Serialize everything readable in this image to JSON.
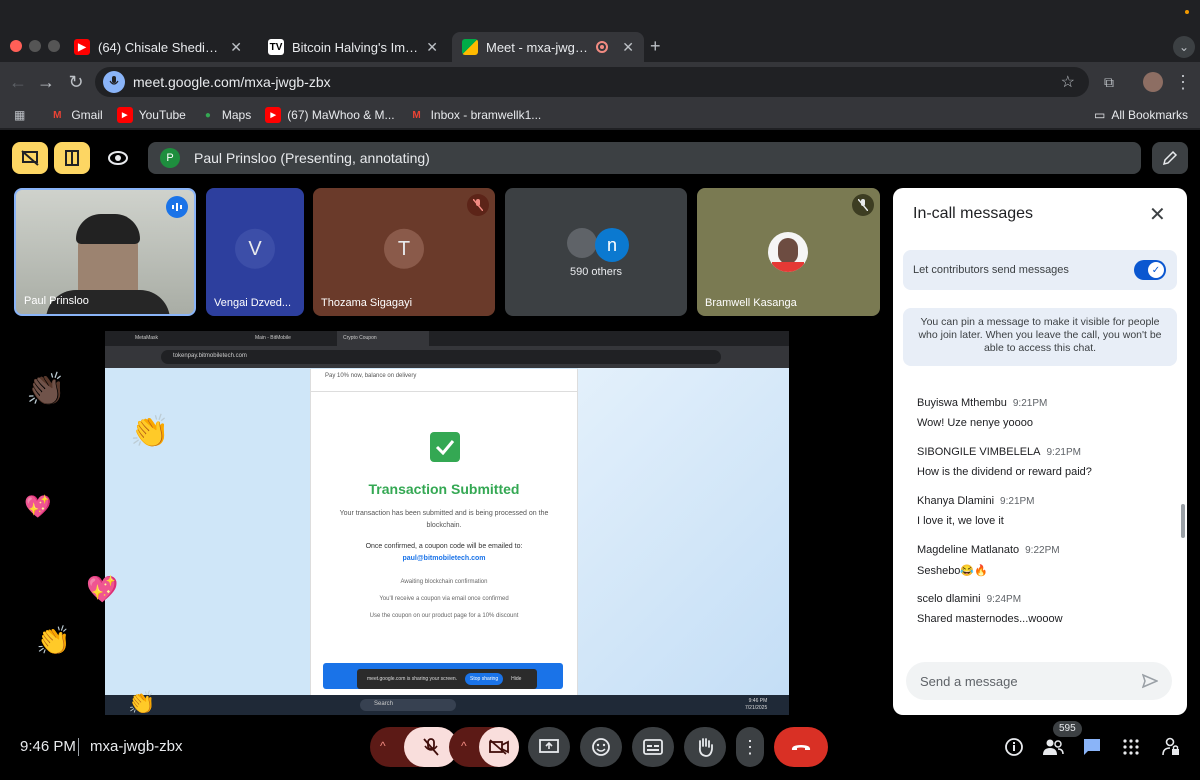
{
  "browser": {
    "tabs": [
      {
        "label": "(64) Chisale Shedia cover - Y",
        "favicon": "youtube-icon"
      },
      {
        "label": "Bitcoin Halving's Impact Anal",
        "favicon": "tv-icon"
      },
      {
        "label": "Meet - mxa-jwgb-zbx",
        "favicon": "meet-icon"
      }
    ],
    "url": "meet.google.com/mxa-jwgb-zbx",
    "bookmarks": [
      "Gmail",
      "YouTube",
      "Maps",
      "(67) MaWhoo & M...",
      "Inbox - bramwellk1..."
    ],
    "all_bookmarks": "All Bookmarks"
  },
  "meet": {
    "presenting_initial": "P",
    "presenting_label": "Paul Prinsloo (Presenting, annotating)",
    "participants": [
      {
        "name": "Paul Prinsloo",
        "initial": ""
      },
      {
        "name": "Vengai Dzved...",
        "initial": "V"
      },
      {
        "name": "Thozama Sigagayi",
        "initial": "T"
      },
      {
        "name": "590 others",
        "initial": "n"
      },
      {
        "name": "Bramwell Kasanga",
        "initial": ""
      }
    ],
    "time": "9:46 PM",
    "meeting_code": "mxa-jwgb-zbx",
    "participant_count": "595"
  },
  "shared_screen": {
    "tabs": [
      "MetaMask",
      "Main - BitMobile",
      "Crypto Coupon"
    ],
    "url": "tokenpay.bitmobiletech.com",
    "top_note": "Pay 10% now, balance on delivery",
    "heading": "Transaction Submitted",
    "body1": "Your transaction has been submitted and is being processed on the blockchain.",
    "body2": "Once confirmed, a coupon code will be emailed to:",
    "email": "paul@bitmobiletech.com",
    "step1": "Awaiting blockchain confirmation",
    "step2": "You'll receive a coupon via email once confirmed",
    "step3": "Use the coupon on our product page for a 10% discount",
    "sharing_notice": "meet.google.com is sharing your screen.",
    "stop_sharing": "Stop sharing",
    "hide": "Hide",
    "search": "Search",
    "clock_time": "9:46 PM",
    "clock_date": "7/21/2025"
  },
  "chat": {
    "title": "In-call messages",
    "toggle_label": "Let contributors send messages",
    "info": "You can pin a message to make it visible for people who join later. When you leave the call, you won't be able to access this chat.",
    "messages": [
      {
        "sender": "Buyiswa Mthembu",
        "time": "9:21PM",
        "text": "Wow! Uze nenye yoooo"
      },
      {
        "sender": "SIBONGILE VIMBELELA",
        "time": "9:21PM",
        "text": "How is the dividend or reward paid?"
      },
      {
        "sender": "Khanya Dlamini",
        "time": "9:21PM",
        "text": "I love it,  we love it"
      },
      {
        "sender": "Magdeline Matlanato",
        "time": "9:22PM",
        "text": "Seshebo😂🔥"
      },
      {
        "sender": "scelo dlamini",
        "time": "9:24PM",
        "text": "Shared masternodes...wooow"
      }
    ],
    "input_placeholder": "Send a message"
  },
  "colors": {
    "accent_blue": "#8ab4f8",
    "toggle_blue": "#0b57d0",
    "hangup_red": "#d93025",
    "mic_off_bg": "#f9dedc",
    "success_green": "#34a853"
  }
}
